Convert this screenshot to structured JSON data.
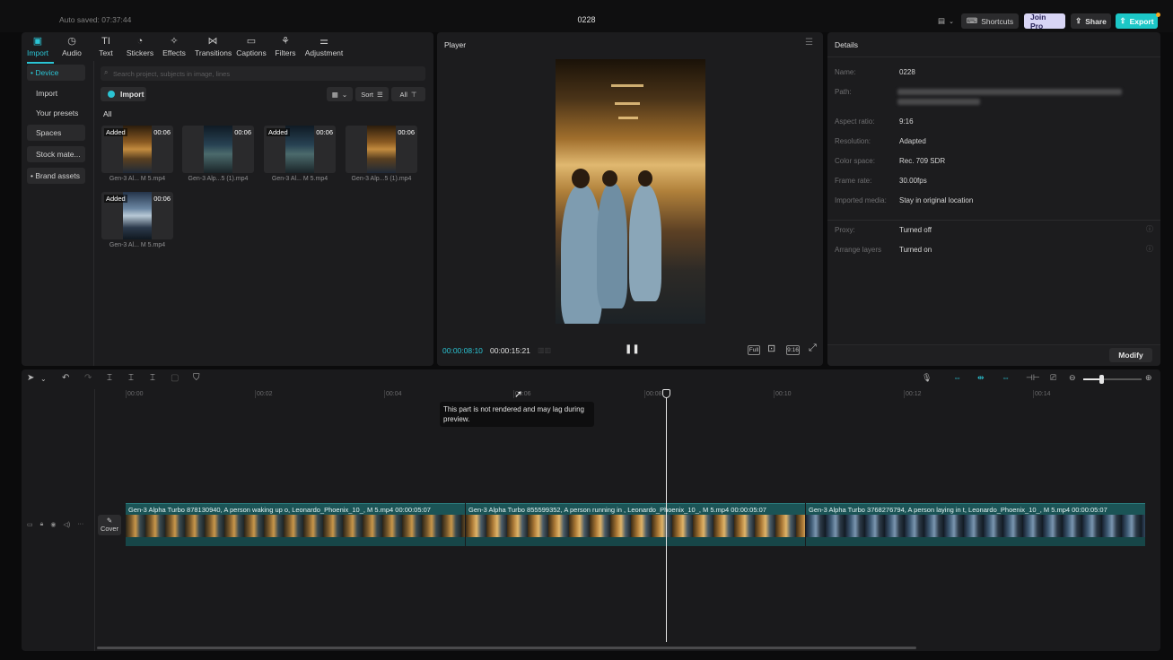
{
  "topbar": {
    "autosave": "Auto saved: 07:37:44",
    "project_name": "0228",
    "shortcuts_label": "Shortcuts",
    "joinpro_label": "Join Pro",
    "share_label": "Share",
    "export_label": "Export"
  },
  "tools": [
    {
      "label": "Import",
      "icon": "import-icon"
    },
    {
      "label": "Audio",
      "icon": "audio-icon"
    },
    {
      "label": "Text",
      "icon": "text-icon"
    },
    {
      "label": "Stickers",
      "icon": "stickers-icon"
    },
    {
      "label": "Effects",
      "icon": "effects-icon"
    },
    {
      "label": "Transitions",
      "icon": "transitions-icon"
    },
    {
      "label": "Captions",
      "icon": "captions-icon"
    },
    {
      "label": "Filters",
      "icon": "filters-icon"
    },
    {
      "label": "Adjustment",
      "icon": "adjustment-icon"
    }
  ],
  "sidebar": {
    "items": [
      {
        "label": "• Device"
      },
      {
        "label": "Import"
      },
      {
        "label": "Your presets"
      },
      {
        "label": "Spaces"
      },
      {
        "label": "Stock mate..."
      },
      {
        "label": "• Brand assets"
      }
    ]
  },
  "media": {
    "search_placeholder": "Search project, subjects in image, lines",
    "import_label": "Import",
    "sort_label": "Sort",
    "all_filter_label": "All",
    "all_section_label": "All",
    "items": [
      {
        "name": "Gen-3 Al... M 5.mp4",
        "duration": "00:06",
        "badge": "Added"
      },
      {
        "name": "Gen-3 Alp...5 (1).mp4",
        "duration": "00:06",
        "badge": ""
      },
      {
        "name": "Gen-3 Al... M 5.mp4",
        "duration": "00:06",
        "badge": "Added"
      },
      {
        "name": "Gen-3 Alp...5 (1).mp4",
        "duration": "00:06",
        "badge": ""
      },
      {
        "name": "Gen-3 Al... M 5.mp4",
        "duration": "00:06",
        "badge": "Added"
      }
    ]
  },
  "player": {
    "title": "Player",
    "time_current": "00:00:08:10",
    "time_total": "00:00:15:21",
    "full_label": "Full",
    "ratio_label": "9:16"
  },
  "details": {
    "title": "Details",
    "rows": [
      {
        "label": "Name:",
        "value": "0228"
      },
      {
        "label": "Path:",
        "value": ""
      },
      {
        "label": "Aspect ratio:",
        "value": "9:16"
      },
      {
        "label": "Resolution:",
        "value": "Adapted"
      },
      {
        "label": "Color space:",
        "value": "Rec. 709 SDR"
      },
      {
        "label": "Frame rate:",
        "value": "30.00fps"
      },
      {
        "label": "Imported media:",
        "value": "Stay in original location"
      },
      {
        "label": "Proxy:",
        "value": "Turned off"
      },
      {
        "label": "Arrange layers",
        "value": "Turned on"
      }
    ],
    "modify_label": "Modify"
  },
  "timeline": {
    "ruler": [
      "00:00",
      "00:02",
      "00:04",
      "00:06",
      "00:08",
      "00:10",
      "00:12",
      "00:14"
    ],
    "tooltip": "This part is not rendered and may lag during preview.",
    "cover_label": "Cover",
    "clips": [
      {
        "label": "Gen-3 Alpha Turbo 878130940, A person waking up o, Leonardo_Phoenix_10_, M 5.mp4  00:00:05:07"
      },
      {
        "label": "Gen-3 Alpha Turbo 855599352, A person running in , Leonardo_Phoenix_10_, M 5.mp4  00:00:05:07"
      },
      {
        "label": "Gen-3 Alpha Turbo 3768276794, A person laying in t, Leonardo_Phoenix_10_, M 5.mp4  00:00:05:07"
      }
    ]
  },
  "colors": {
    "accent": "#2bc4d4",
    "export": "#1cc7c7",
    "joinpro": "#d8d5f5",
    "clip": "#1b5456"
  }
}
